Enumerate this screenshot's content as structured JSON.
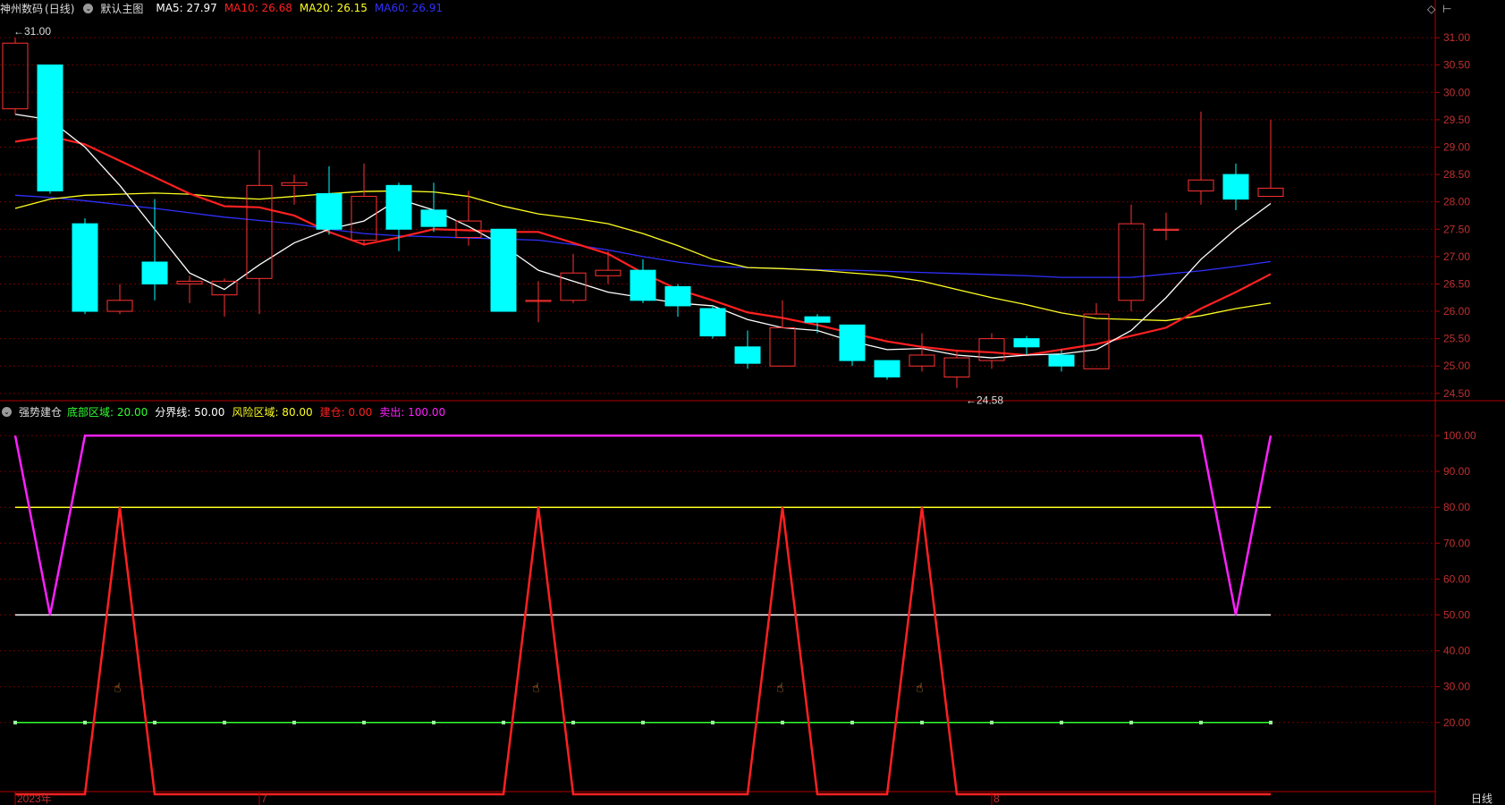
{
  "stock": {
    "name": "神州数码",
    "period": "(日线)",
    "template": "默认主图",
    "ma": [
      {
        "label": "MA5:",
        "value": "27.97",
        "color": "#ffffff",
        "data": [
          29.6,
          29.5,
          29.0,
          28.3,
          27.5,
          26.7,
          26.4,
          26.85,
          27.25,
          27.5,
          27.65,
          28.05,
          27.85,
          27.55,
          27.2,
          26.75,
          26.55,
          26.35,
          26.25,
          26.15,
          26.1,
          25.85,
          25.7,
          25.65,
          25.45,
          25.3,
          25.32,
          25.2,
          25.15,
          25.2,
          25.22,
          25.3,
          25.65,
          26.25,
          26.95,
          27.5,
          27.97
        ]
      },
      {
        "label": "MA10:",
        "value": "26.68",
        "color": "#ff2020",
        "data": [
          29.1,
          29.2,
          29.05,
          28.75,
          28.45,
          28.15,
          27.92,
          27.9,
          27.75,
          27.45,
          27.22,
          27.35,
          27.5,
          27.48,
          27.45,
          27.45,
          27.25,
          27.05,
          26.7,
          26.4,
          26.2,
          25.98,
          25.88,
          25.75,
          25.6,
          25.45,
          25.35,
          25.28,
          25.25,
          25.2,
          25.3,
          25.4,
          25.55,
          25.7,
          26.05,
          26.35,
          26.68
        ]
      },
      {
        "label": "MA20:",
        "value": "26.15",
        "color": "#ffff20",
        "data": [
          27.88,
          28.05,
          28.12,
          28.14,
          28.16,
          28.14,
          28.08,
          28.05,
          28.1,
          28.15,
          28.19,
          28.2,
          28.18,
          28.1,
          27.92,
          27.78,
          27.7,
          27.6,
          27.42,
          27.2,
          26.95,
          26.8,
          26.78,
          26.75,
          26.7,
          26.65,
          26.55,
          26.4,
          26.25,
          26.12,
          25.97,
          25.87,
          25.85,
          25.83,
          25.92,
          26.05,
          26.15
        ]
      },
      {
        "label": "MA60:",
        "value": "26.91",
        "color": "#3030ff",
        "data": [
          28.12,
          28.08,
          28.02,
          27.95,
          27.88,
          27.8,
          27.72,
          27.66,
          27.6,
          27.5,
          27.42,
          27.38,
          27.36,
          27.34,
          27.32,
          27.3,
          27.22,
          27.12,
          27.0,
          26.9,
          26.82,
          26.8,
          26.78,
          26.76,
          26.75,
          26.73,
          26.71,
          26.69,
          26.67,
          26.65,
          26.62,
          26.62,
          26.62,
          26.68,
          26.74,
          26.82,
          26.91
        ]
      }
    ],
    "candles": [
      {
        "o": 29.7,
        "c": 30.9,
        "h": 31.0,
        "l": 29.6
      },
      {
        "o": 30.5,
        "c": 28.2,
        "h": 30.5,
        "l": 28.15
      },
      {
        "o": 27.6,
        "c": 26.0,
        "h": 27.7,
        "l": 25.95
      },
      {
        "o": 26.0,
        "c": 26.2,
        "h": 26.5,
        "l": 25.95
      },
      {
        "o": 26.9,
        "c": 26.5,
        "h": 28.05,
        "l": 26.2
      },
      {
        "o": 26.5,
        "c": 26.55,
        "h": 26.65,
        "l": 26.15
      },
      {
        "o": 26.3,
        "c": 26.55,
        "h": 26.6,
        "l": 25.9
      },
      {
        "o": 26.6,
        "c": 28.3,
        "h": 28.95,
        "l": 25.95
      },
      {
        "o": 28.3,
        "c": 28.35,
        "h": 28.5,
        "l": 27.95
      },
      {
        "o": 28.15,
        "c": 27.5,
        "h": 28.65,
        "l": 27.4
      },
      {
        "o": 27.3,
        "c": 28.1,
        "h": 28.7,
        "l": 27.2
      },
      {
        "o": 28.3,
        "c": 27.5,
        "h": 28.35,
        "l": 27.1
      },
      {
        "o": 27.85,
        "c": 27.55,
        "h": 28.35,
        "l": 27.45
      },
      {
        "o": 27.35,
        "c": 27.65,
        "h": 28.2,
        "l": 27.2
      },
      {
        "o": 27.5,
        "c": 26.0,
        "h": 27.5,
        "l": 26.0
      },
      {
        "o": 26.2,
        "c": 26.2,
        "h": 26.55,
        "l": 25.8
      },
      {
        "o": 26.2,
        "c": 26.7,
        "h": 27.05,
        "l": 26.15
      },
      {
        "o": 26.65,
        "c": 26.75,
        "h": 27.1,
        "l": 26.5
      },
      {
        "o": 26.75,
        "c": 26.2,
        "h": 26.95,
        "l": 26.15
      },
      {
        "o": 26.45,
        "c": 26.1,
        "h": 26.5,
        "l": 25.9
      },
      {
        "o": 26.05,
        "c": 25.55,
        "h": 26.1,
        "l": 25.5
      },
      {
        "o": 25.35,
        "c": 25.05,
        "h": 25.65,
        "l": 24.95
      },
      {
        "o": 25.0,
        "c": 25.7,
        "h": 26.2,
        "l": 25.0
      },
      {
        "o": 25.9,
        "c": 25.8,
        "h": 25.95,
        "l": 25.6
      },
      {
        "o": 25.75,
        "c": 25.1,
        "h": 25.75,
        "l": 25.0
      },
      {
        "o": 25.1,
        "c": 24.8,
        "h": 25.1,
        "l": 24.75
      },
      {
        "o": 25.0,
        "c": 25.2,
        "h": 25.6,
        "l": 24.9
      },
      {
        "o": 24.8,
        "c": 25.15,
        "h": 25.3,
        "l": 24.6
      },
      {
        "o": 25.1,
        "c": 25.5,
        "h": 25.6,
        "l": 24.95
      },
      {
        "o": 25.5,
        "c": 25.35,
        "h": 25.55,
        "l": 25.2
      },
      {
        "o": 25.2,
        "c": 25.0,
        "h": 25.3,
        "l": 24.9
      },
      {
        "o": 24.95,
        "c": 25.95,
        "h": 26.15,
        "l": 24.95
      },
      {
        "o": 26.2,
        "c": 27.6,
        "h": 27.95,
        "l": 26.0
      },
      {
        "o": 27.5,
        "c": 27.5,
        "h": 27.8,
        "l": 27.3
      },
      {
        "o": 28.2,
        "c": 28.4,
        "h": 29.65,
        "l": 27.95
      },
      {
        "o": 28.5,
        "c": 28.05,
        "h": 28.7,
        "l": 27.85
      },
      {
        "o": 28.1,
        "c": 28.25,
        "h": 29.5,
        "l": 28.1
      }
    ],
    "high_label": "31.00",
    "low_label": "24.58",
    "y_ticks": [
      "31.00",
      "30.50",
      "30.00",
      "29.50",
      "29.00",
      "28.50",
      "28.00",
      "27.50",
      "27.00",
      "26.50",
      "26.00",
      "25.50",
      "25.00",
      "24.50"
    ],
    "y_min": 24.35,
    "y_max": 31.1
  },
  "indicator": {
    "name": "强势建仓",
    "params": [
      {
        "label": "底部区域:",
        "value": "20.00",
        "color": "#30ff30"
      },
      {
        "label": "分界线:",
        "value": "50.00",
        "color": "#ffffff"
      },
      {
        "label": "风险区域:",
        "value": "80.00",
        "color": "#ffff20"
      },
      {
        "label": "建仓:",
        "value": "0.00",
        "color": "#ff2020"
      },
      {
        "label": "卖出:",
        "value": "100.00",
        "color": "#ff20ff"
      }
    ],
    "y_ticks": [
      "100.00",
      "90.00",
      "80.00",
      "70.00",
      "60.00",
      "50.00",
      "40.00",
      "30.00",
      "20.00"
    ],
    "y_min": 0,
    "y_max": 100,
    "jiancang": [
      0,
      0,
      0,
      80,
      0,
      0,
      0,
      0,
      0,
      0,
      0,
      0,
      0,
      0,
      0,
      80,
      0,
      0,
      0,
      0,
      0,
      0,
      80,
      0,
      0,
      0,
      80,
      0,
      0,
      0,
      0,
      0,
      0,
      0,
      0,
      0,
      0
    ],
    "maichu": [
      100,
      50,
      100,
      100,
      100,
      100,
      100,
      100,
      100,
      100,
      100,
      100,
      100,
      100,
      100,
      100,
      100,
      100,
      100,
      100,
      100,
      100,
      100,
      100,
      100,
      100,
      100,
      100,
      100,
      100,
      100,
      100,
      100,
      100,
      100,
      50,
      100
    ],
    "signal_bars": [
      3,
      15,
      22,
      26
    ]
  },
  "xaxis": {
    "labels": [
      {
        "text": "2023年",
        "idx": 0
      },
      {
        "text": "7",
        "idx": 7
      },
      {
        "text": "8",
        "idx": 28
      }
    ],
    "period_button": "日线"
  },
  "colors": {
    "up": "#ff3232",
    "down": "#00ffff",
    "axis": "#b00000",
    "grid": "#6a0000",
    "hand": "#f0a040"
  }
}
